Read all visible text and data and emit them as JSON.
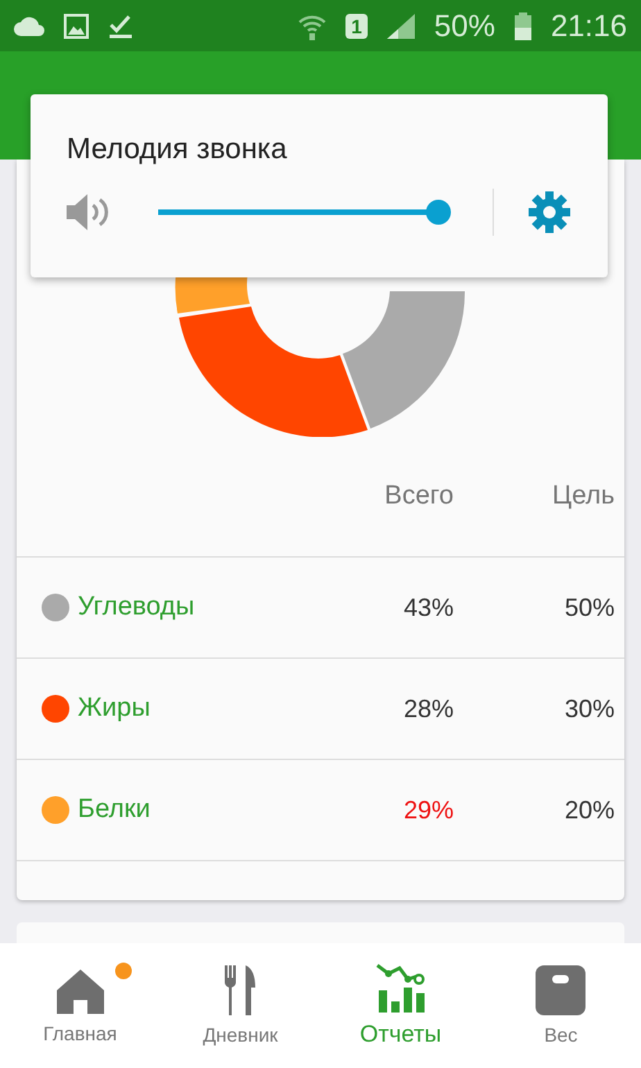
{
  "status_bar": {
    "sim": "1",
    "battery": "50%",
    "time": "21:16"
  },
  "report": {
    "columns": [
      "Всего",
      "Цель"
    ],
    "rows": [
      {
        "name": "Углеводы",
        "color": "#aaaaaa",
        "total": "43%",
        "goal": "50%",
        "over": false
      },
      {
        "name": "Жиры",
        "color": "#ff4500",
        "total": "28%",
        "goal": "30%",
        "over": false
      },
      {
        "name": "Белки",
        "color": "#ffa02a",
        "total": "29%",
        "goal": "20%",
        "over": true
      }
    ]
  },
  "volume_dialog": {
    "title": "Мелодия звонка",
    "level": 1
  },
  "bottom_nav": [
    {
      "kind": "home",
      "label": "Главная",
      "selected": false,
      "badge": true
    },
    {
      "kind": "diary",
      "label": "Дневник",
      "selected": false,
      "badge": false
    },
    {
      "kind": "reports",
      "label": "Отчеты",
      "selected": true,
      "badge": false
    },
    {
      "kind": "weight",
      "label": "Вес",
      "selected": false,
      "badge": false
    }
  ]
}
